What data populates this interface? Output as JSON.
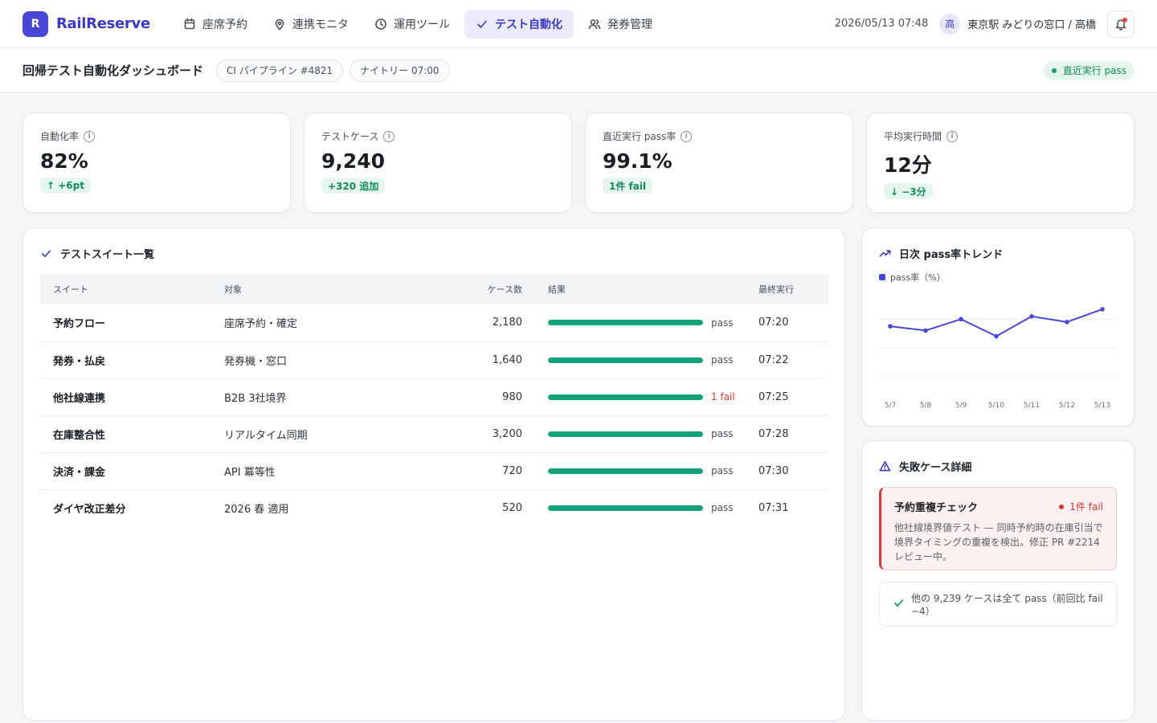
{
  "brand": {
    "mark": "R",
    "name": "RailReserve"
  },
  "nav": [
    {
      "label": "座席予約",
      "icon": "calendar-icon",
      "active": false
    },
    {
      "label": "連携モニタ",
      "icon": "map-pin-icon",
      "active": false
    },
    {
      "label": "運用ツール",
      "icon": "clock-icon",
      "active": false
    },
    {
      "label": "テスト自動化",
      "icon": "check-icon",
      "active": true
    },
    {
      "label": "発券管理",
      "icon": "users-icon",
      "active": false
    }
  ],
  "header": {
    "datetime": "2026/05/13 07:48",
    "avatar": "高",
    "user": "東京駅 みどりの窓口 / 高橋"
  },
  "subbar": {
    "title": "回帰テスト自動化ダッシュボード",
    "chips": [
      "CI パイプライン #4821",
      "ナイトリー 07:00"
    ],
    "status": "直近実行 pass"
  },
  "kpis": [
    {
      "label": "自動化率",
      "value": "82%",
      "badge": "↑ +6pt"
    },
    {
      "label": "テストケース",
      "value": "9,240",
      "badge": "+320 追加"
    },
    {
      "label": "直近実行 pass率",
      "value": "99.1%",
      "badge": "1件 fail"
    },
    {
      "label": "平均実行時間",
      "value": "12分",
      "badge": "↓ −3分"
    }
  ],
  "suites": {
    "title": "テストスイート一覧",
    "columns": [
      "スイート",
      "対象",
      "ケース数",
      "結果",
      "最終実行"
    ],
    "rows": [
      {
        "suite": "予約フロー",
        "target": "座席予約・確定",
        "count": "2,180",
        "result": "pass",
        "fail": false,
        "pass_ratio": 1.0,
        "last": "07:20"
      },
      {
        "suite": "発券・払戻",
        "target": "発券機・窓口",
        "count": "1,640",
        "result": "pass",
        "fail": false,
        "pass_ratio": 1.0,
        "last": "07:22"
      },
      {
        "suite": "他社線連携",
        "target": "B2B 3社境界",
        "count": "980",
        "result": "1 fail",
        "fail": true,
        "pass_ratio": 0.999,
        "last": "07:25"
      },
      {
        "suite": "在庫整合性",
        "target": "リアルタイム同期",
        "count": "3,200",
        "result": "pass",
        "fail": false,
        "pass_ratio": 1.0,
        "last": "07:28"
      },
      {
        "suite": "決済・課金",
        "target": "API 冪等性",
        "count": "720",
        "result": "pass",
        "fail": false,
        "pass_ratio": 1.0,
        "last": "07:30"
      },
      {
        "suite": "ダイヤ改正差分",
        "target": "2026 春 適用",
        "count": "520",
        "result": "pass",
        "fail": false,
        "pass_ratio": 1.0,
        "last": "07:31"
      }
    ]
  },
  "trend": {
    "title": "日次 pass率トレンド",
    "legend": "pass率（%）",
    "color": "#4a47d6"
  },
  "chart_data": {
    "type": "line",
    "x": [
      "5/7",
      "5/8",
      "5/9",
      "5/10",
      "5/11",
      "5/12",
      "5/13"
    ],
    "series": [
      {
        "name": "pass率（%）",
        "values": [
          98.5,
          98.2,
          99.0,
          97.8,
          99.2,
          98.8,
          99.7
        ]
      }
    ],
    "ylim": [
      95,
      101
    ],
    "grid": true
  },
  "fails": {
    "title": "失敗ケース詳細",
    "case_name": "予約重複チェック",
    "case_tag": "1件 fail",
    "case_desc": "他社線境界値テスト — 同時予約時の在庫引当で境界タイミングの重複を検出。修正 PR #2214 レビュー中。",
    "ok_text": "他の 9,239 ケースは全て pass（前回比 fail −4）"
  }
}
